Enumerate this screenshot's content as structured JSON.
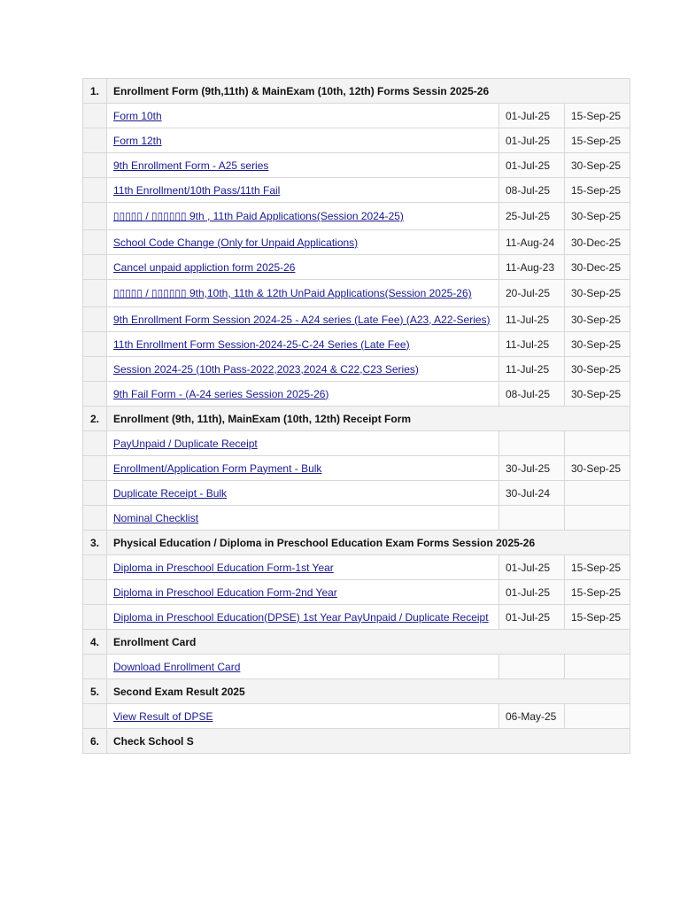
{
  "sections": [
    {
      "num": "1.",
      "title": "Enrollment Form (9th,11th) & MainExam (10th, 12th) Forms Sessin 2025-26",
      "items": [
        {
          "label": "Form 10th",
          "start": "01-Jul-25",
          "end": "15-Sep-25"
        },
        {
          "label": "Form 12th",
          "start": "01-Jul-25",
          "end": "15-Sep-25"
        },
        {
          "label": "9th Enrollment Form - A25 series",
          "start": "01-Jul-25",
          "end": "30-Sep-25"
        },
        {
          "label": "11th Enrollment/10th Pass/11th Fail",
          "start": "08-Jul-25",
          "end": "15-Sep-25"
        },
        {
          "label": "▯▯▯▯▯ / ▯▯▯▯▯▯ 9th , 11th Paid Applications(Session 2024-25)",
          "start": "25-Jul-25",
          "end": "30-Sep-25",
          "tall": true
        },
        {
          "label": "School Code Change (Only for Unpaid Applications)",
          "start": "11-Aug-24",
          "end": "30-Dec-25"
        },
        {
          "label": "Cancel unpaid appliction form 2025-26",
          "start": "11-Aug-23",
          "end": "30-Dec-25"
        },
        {
          "label": "▯▯▯▯▯ / ▯▯▯▯▯▯ 9th,10th, 11th & 12th UnPaid Applications(Session 2025-26)",
          "start": "20-Jul-25",
          "end": "30-Sep-25",
          "tall": true
        },
        {
          "label": "9th Enrollment Form Session 2024-25 - A24 series (Late Fee) (A23, A22-Series)",
          "start": "11-Jul-25",
          "end": "30-Sep-25"
        },
        {
          "label": "11th Enrollment Form Session-2024-25-C-24 Series (Late Fee)",
          "start": "11-Jul-25",
          "end": "30-Sep-25"
        },
        {
          "label": "Session 2024-25 (10th Pass-2022,2023,2024 & C22,C23 Series)",
          "start": "11-Jul-25",
          "end": "30-Sep-25"
        },
        {
          "label": "9th Fail Form - (A-24 series Session 2025-26)",
          "start": "08-Jul-25",
          "end": "30-Sep-25"
        }
      ]
    },
    {
      "num": "2.",
      "title": "Enrollment (9th, 11th), MainExam (10th, 12th) Receipt Form",
      "items": [
        {
          "label": "PayUnpaid / Duplicate Receipt",
          "start": "",
          "end": ""
        },
        {
          "label": "Enrollment/Application Form Payment - Bulk",
          "start": "30-Jul-25",
          "end": "30-Sep-25"
        },
        {
          "label": "Duplicate Receipt - Bulk",
          "start": "30-Jul-24",
          "end": ""
        },
        {
          "label": "Nominal Checklist",
          "start": "",
          "end": ""
        }
      ]
    },
    {
      "num": "3.",
      "title": "Physical Education / Diploma in Preschool Education Exam Forms Session 2025-26",
      "items": [
        {
          "label": "Diploma in Preschool Education Form-1st Year",
          "start": "01-Jul-25",
          "end": "15-Sep-25"
        },
        {
          "label": "Diploma in Preschool Education Form-2nd Year",
          "start": "01-Jul-25",
          "end": "15-Sep-25"
        },
        {
          "label": "Diploma in Preschool Education(DPSE) 1st Year PayUnpaid / Duplicate Receipt",
          "start": "01-Jul-25",
          "end": "15-Sep-25"
        }
      ]
    },
    {
      "num": "4.",
      "title": "Enrollment Card",
      "items": [
        {
          "label": "Download Enrollment Card",
          "start": "",
          "end": ""
        }
      ]
    },
    {
      "num": "5.",
      "title": "Second Exam Result 2025",
      "items": [
        {
          "label": "View Result of DPSE",
          "start": "06-May-25",
          "end": ""
        }
      ]
    },
    {
      "num": "6.",
      "title": "Check School S",
      "items": []
    }
  ]
}
